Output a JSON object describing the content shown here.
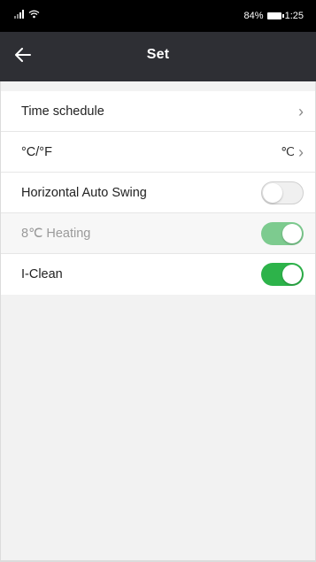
{
  "status_bar": {
    "signal_icon": "signal-icon",
    "wifi_icon": "wifi-icon",
    "battery_percent": "84%",
    "time": "1:25"
  },
  "header": {
    "title": "Set",
    "back_icon": "arrow-left-icon"
  },
  "settings": {
    "time_schedule": {
      "label": "Time schedule"
    },
    "temp_unit": {
      "label": "°C/°F",
      "value": "℃"
    },
    "horizontal_swing": {
      "label": "Horizontal Auto Swing",
      "state": "off"
    },
    "heating_8c": {
      "label": "8℃ Heating",
      "state": "on",
      "disabled": true
    },
    "i_clean": {
      "label": "I-Clean",
      "state": "on"
    }
  },
  "colors": {
    "header_bg": "#2e2f34",
    "toggle_on": "#2db34a",
    "toggle_on_disabled": "#7dcb8f"
  }
}
